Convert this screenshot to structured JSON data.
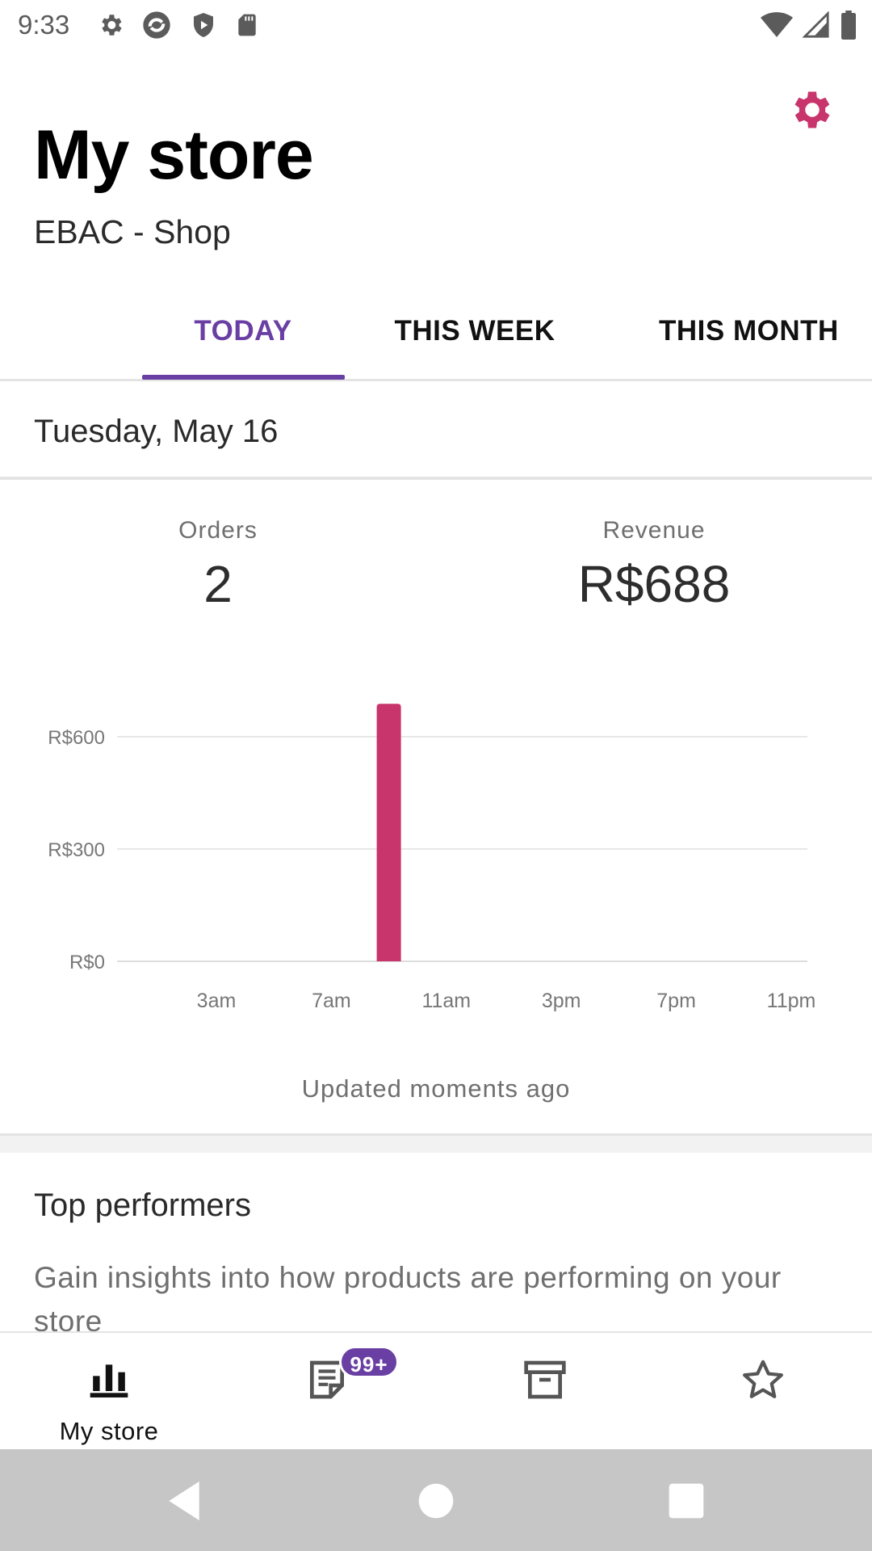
{
  "status_bar": {
    "time": "9:33"
  },
  "header": {
    "title": "My store",
    "store_name": "EBAC - Shop"
  },
  "tabs": [
    {
      "label": "TODAY",
      "active": true
    },
    {
      "label": "THIS WEEK",
      "active": false
    },
    {
      "label": "THIS MONTH",
      "active": false
    }
  ],
  "date_label": "Tuesday, May 16",
  "stats": {
    "orders": {
      "label": "Orders",
      "value": "2"
    },
    "revenue": {
      "label": "Revenue",
      "value": "R$688"
    }
  },
  "chart_data": {
    "type": "bar",
    "categories": [
      "3am",
      "7am",
      "11am",
      "3pm",
      "7pm",
      "11pm"
    ],
    "y_ticks": [
      "R$0",
      "R$300",
      "R$600"
    ],
    "ylim": [
      0,
      600
    ],
    "bars": [
      {
        "hour": 9,
        "value": 688
      }
    ],
    "bar_color": "#c8346c",
    "grid": true
  },
  "updated_text": "Updated moments ago",
  "top_performers": {
    "title": "Top performers",
    "description": "Gain insights into how products are performing on your store"
  },
  "bottom_nav": {
    "items": [
      {
        "label": "My store",
        "icon": "bar-chart-icon"
      },
      {
        "label": "",
        "icon": "orders-icon",
        "badge": "99+"
      },
      {
        "label": "",
        "icon": "archive-icon"
      },
      {
        "label": "",
        "icon": "star-icon"
      }
    ]
  },
  "colors": {
    "accent": "#6a3fa3",
    "brand": "#c8346c"
  }
}
